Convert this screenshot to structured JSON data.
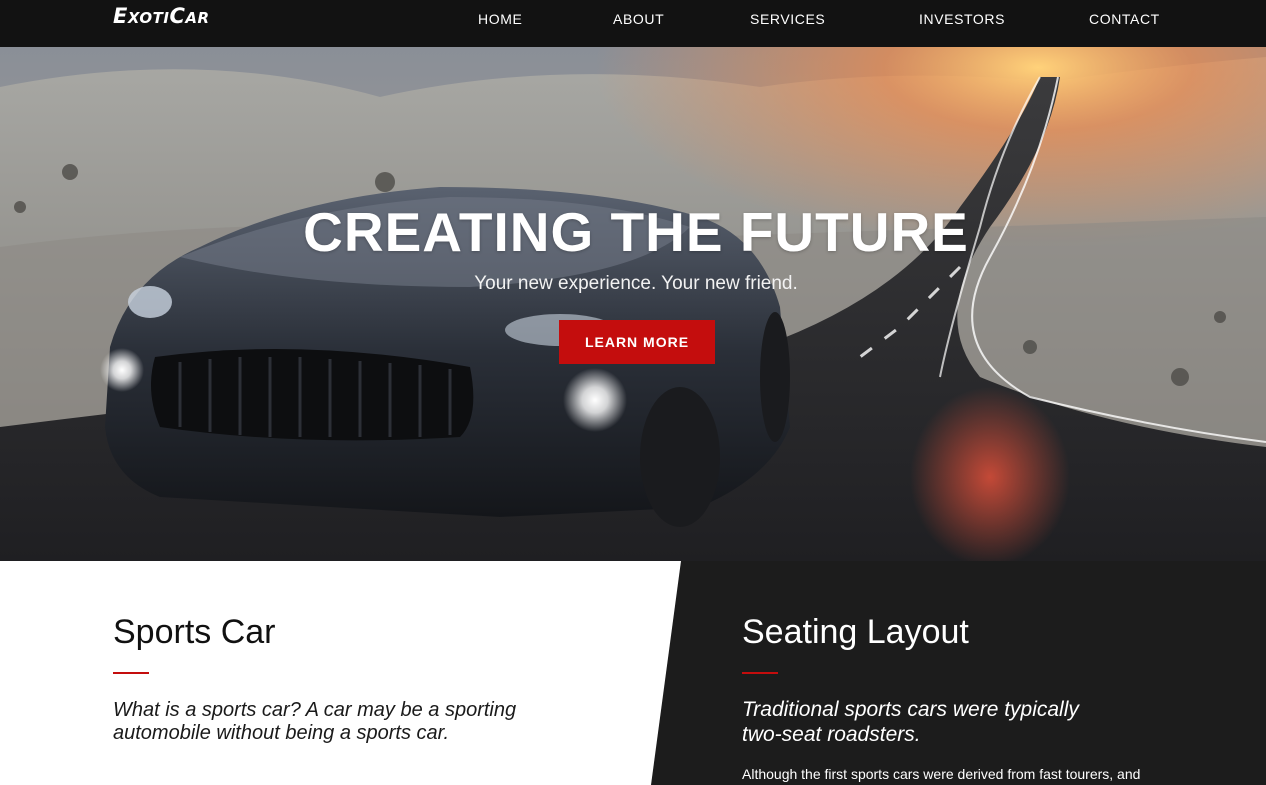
{
  "nav": {
    "logo": "ExotiCar",
    "links": [
      "HOME",
      "ABOUT",
      "SERVICES",
      "INVESTORS",
      "CONTACT"
    ]
  },
  "hero": {
    "title": "CREATING THE FUTURE",
    "subtitle": "Your new experience. Your new friend.",
    "button": "LEARN MORE"
  },
  "sections": {
    "left": {
      "title": "Sports Car",
      "text": "What is a sports car? A car may be a sporting automobile without being a sports car."
    },
    "right": {
      "title": "Seating Layout",
      "lead": "Traditional sports cars were typically two-seat roadsters.",
      "body": "Although the first sports cars were derived from fast tourers, and"
    }
  },
  "colors": {
    "accent": "#c40d0d",
    "nav_bg": "#121212",
    "dark_panel": "#1c1c1c"
  }
}
